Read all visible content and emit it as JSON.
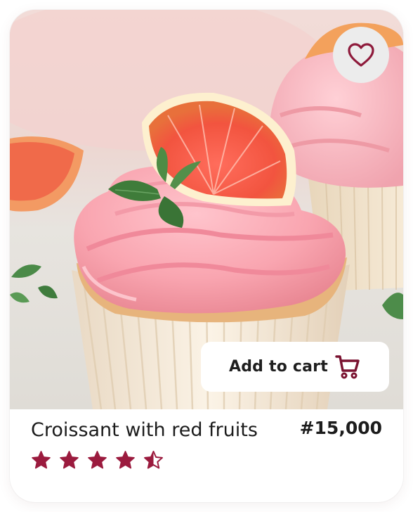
{
  "product": {
    "name": "Croissant with red fruits",
    "price": "#15,000",
    "rating": 4.5,
    "rating_max": 5
  },
  "actions": {
    "add_to_cart_label": "Add to cart",
    "favorite_icon": "heart-icon",
    "cart_icon": "cart-icon"
  },
  "colors": {
    "accent": "#9b1b3e",
    "card_background": "#ffffff",
    "favorite_button_bg": "#ececec"
  }
}
